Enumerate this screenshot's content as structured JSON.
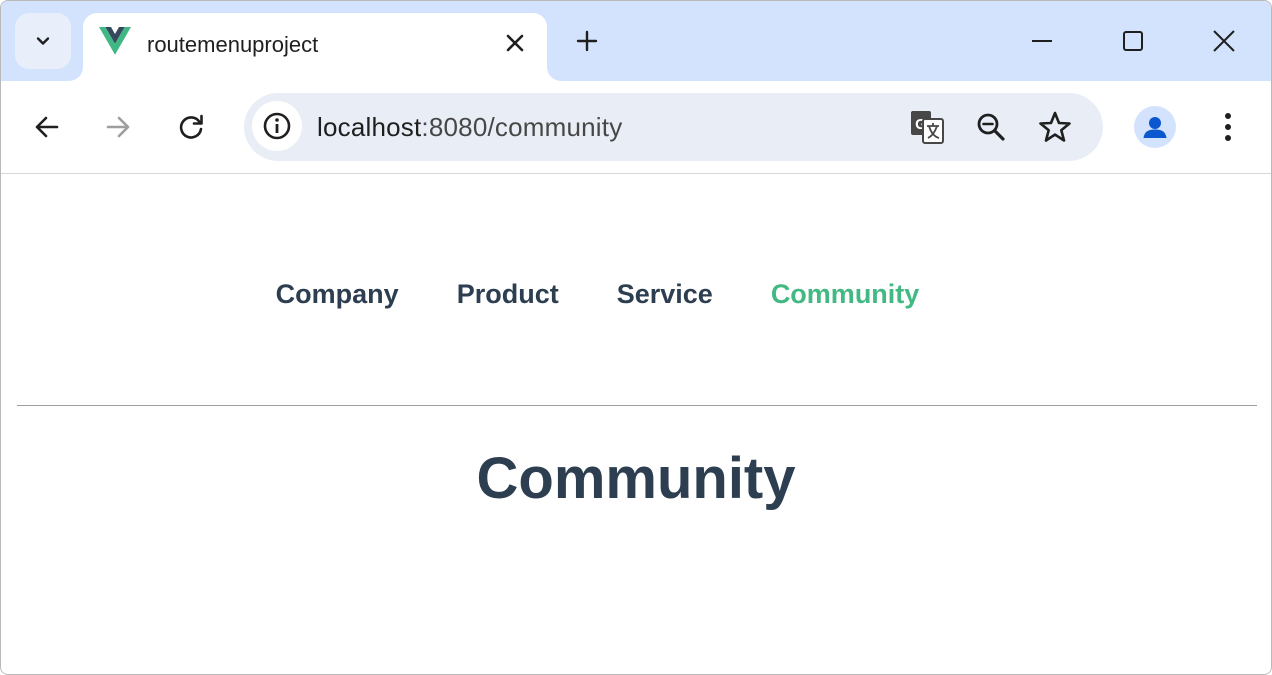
{
  "browser": {
    "tab_title": "routemenuproject",
    "url_host": "localhost",
    "url_path": ":8080/community",
    "icons": {
      "tab_search": "chevron-down-icon",
      "favicon": "vue-logo-icon",
      "tab_close": "close-icon",
      "new_tab": "plus-icon",
      "minimize": "minimize-icon",
      "maximize": "maximize-icon",
      "window_close": "close-icon",
      "back": "arrow-left-icon",
      "forward": "arrow-right-icon",
      "reload": "reload-icon",
      "site_info": "info-icon",
      "translate": "translate-icon",
      "zoom": "zoom-out-icon",
      "bookmark": "star-icon",
      "profile": "person-icon",
      "menu": "kebab-menu-icon"
    },
    "colors": {
      "tabstrip": "#d3e3fd",
      "omnibox": "#e9eef6",
      "profile_accent": "#0b57d0"
    }
  },
  "app": {
    "nav": [
      {
        "label": "Company",
        "active": false
      },
      {
        "label": "Product",
        "active": false
      },
      {
        "label": "Service",
        "active": false
      },
      {
        "label": "Community",
        "active": true
      }
    ],
    "heading": "Community",
    "colors": {
      "text": "#2c3e50",
      "active_link": "#42b983"
    }
  }
}
